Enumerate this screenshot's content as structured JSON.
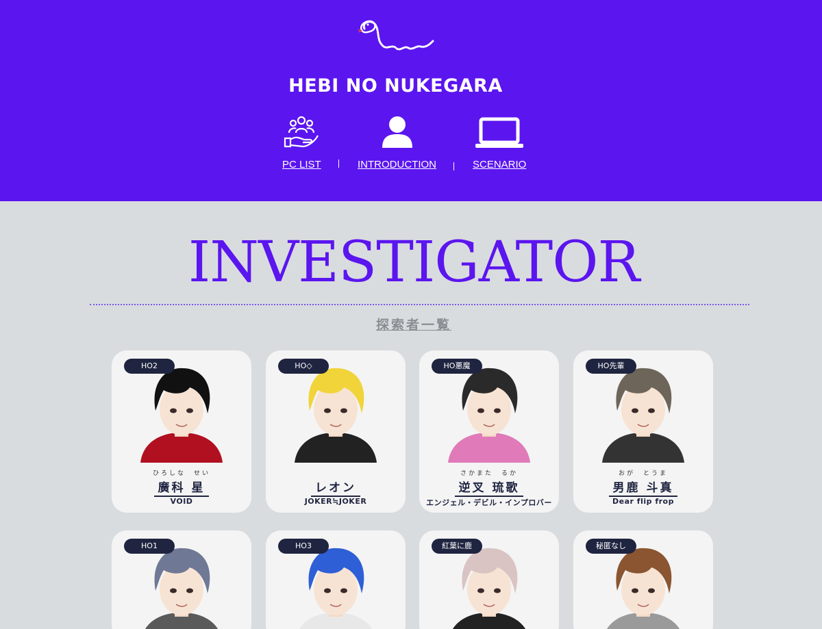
{
  "site": {
    "title": "HEBI NO NUKEGARA",
    "logo_icon": "snake-icon"
  },
  "nav": [
    {
      "label": "PC LIST",
      "icon": "people-hand-icon"
    },
    {
      "label": "INTRODUCTION",
      "icon": "person-icon"
    },
    {
      "label": "SCENARIO",
      "icon": "laptop-icon"
    }
  ],
  "section": {
    "title": "INVESTIGATOR",
    "subtitle": "探索者一覧"
  },
  "cards": [
    {
      "badge": "HO2",
      "ruby": "ひろしな　せい",
      "name": "廣科 星",
      "scenario": "VOID",
      "hair": "#111111",
      "shirt": "#b01020"
    },
    {
      "badge": "HO◇",
      "ruby": "",
      "name": "レオン",
      "scenario": "JOKER≒JOKER",
      "hair": "#f0d43a",
      "shirt": "#222222"
    },
    {
      "badge": "HO悪魔",
      "ruby": "さかまた　るか",
      "name": "逆叉 琉歌",
      "scenario": "エンジェル・デビル・インプロバー",
      "hair": "#2a2a2a",
      "shirt": "#e07ab8"
    },
    {
      "badge": "HO先輩",
      "ruby": "おが　とうま",
      "name": "男鹿 斗真",
      "scenario": "Dear flip frop",
      "hair": "#6e655a",
      "shirt": "#333333"
    },
    {
      "badge": "HO1",
      "ruby": "",
      "name": "",
      "scenario": "",
      "hair": "#6f7894",
      "shirt": "#5a5a5a"
    },
    {
      "badge": "HO3",
      "ruby": "",
      "name": "",
      "scenario": "",
      "hair": "#2f5fd6",
      "shirt": "#e8e8e8"
    },
    {
      "badge": "紅葉に鹿",
      "ruby": "",
      "name": "",
      "scenario": "",
      "hair": "#d9c3c3",
      "shirt": "#222222"
    },
    {
      "badge": "秘匿なし",
      "ruby": "",
      "name": "",
      "scenario": "",
      "hair": "#8a5530",
      "shirt": "#9a9a9a"
    }
  ],
  "colors": {
    "header_bg": "#5b15ef",
    "page_bg": "#d9dcdf",
    "accent": "#5b15ef",
    "badge_bg": "#1f2440"
  }
}
